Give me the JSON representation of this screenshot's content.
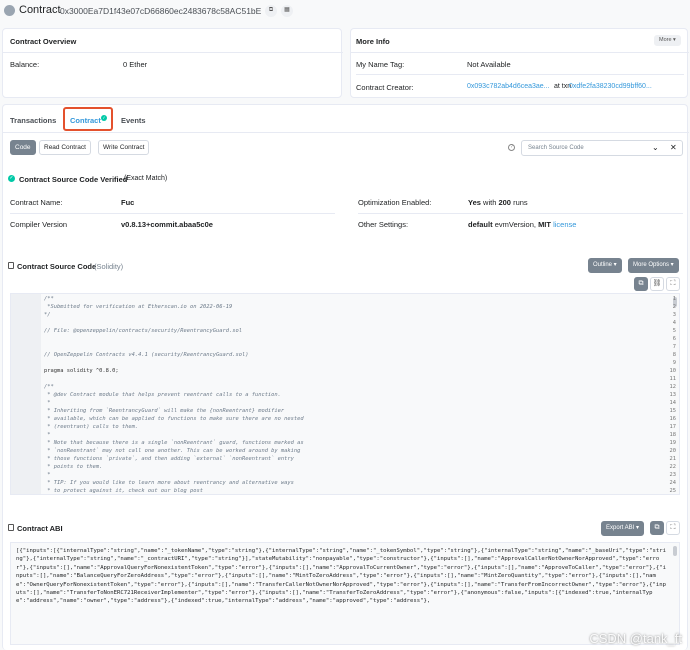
{
  "header": {
    "title": "Contract",
    "address": "0x3000Ea7D1f43e07cD66860ec2483678c58AC51bE"
  },
  "overview": {
    "title": "Contract Overview",
    "balance_label": "Balance:",
    "balance_value": "0 Ether"
  },
  "more_info": {
    "title": "More Info",
    "more_button": "More",
    "name_tag_label": "My Name Tag:",
    "name_tag_value": "Not Available",
    "creator_label": "Contract Creator:",
    "creator_address": "0x093c782ab4d6cea3ae...",
    "creator_at": "at txn",
    "creator_txn": "0xdfe2fa38230cd99bff60..."
  },
  "tabs": {
    "transactions": "Transactions",
    "contract": "Contract",
    "events": "Events"
  },
  "subtabs": {
    "code": "Code",
    "read": "Read Contract",
    "write": "Write Contract"
  },
  "search": {
    "placeholder": "Search Source Code"
  },
  "verified": {
    "text": "Contract Source Code Verified",
    "note": "(Exact Match)"
  },
  "details": {
    "name_label": "Contract Name:",
    "name_value": "Fuc",
    "compiler_label": "Compiler Version",
    "compiler_value": "v0.8.13+commit.abaa5c0e",
    "opt_label": "Optimization Enabled:",
    "opt_yes": "Yes",
    "opt_with": "with",
    "opt_runs": "200",
    "opt_runs_word": "runs",
    "settings_label": "Other Settings:",
    "settings_default": "default",
    "settings_evm": "evmVersion,",
    "settings_mit": "MIT",
    "settings_license": "license"
  },
  "source": {
    "title": "Contract Source Code",
    "lang": "(Solidity)",
    "outline": "Outline",
    "more_options": "More Options"
  },
  "code_lines": [
    {
      "n": "1",
      "t": "/**"
    },
    {
      "n": "2",
      "t": " *Submitted for verification at Etherscan.io on 2022-06-19"
    },
    {
      "n": "3",
      "t": "*/"
    },
    {
      "n": "4",
      "t": ""
    },
    {
      "n": "5",
      "t": "// File: @openzeppelin/contracts/security/ReentrancyGuard.sol"
    },
    {
      "n": "6",
      "t": ""
    },
    {
      "n": "7",
      "t": ""
    },
    {
      "n": "8",
      "t": "// OpenZeppelin Contracts v4.4.1 (security/ReentrancyGuard.sol)"
    },
    {
      "n": "9",
      "t": ""
    },
    {
      "n": "10",
      "t": "pragma solidity ^0.8.0;"
    },
    {
      "n": "11",
      "t": ""
    },
    {
      "n": "12",
      "t": "/**"
    },
    {
      "n": "13",
      "t": " * @dev Contract module that helps prevent reentrant calls to a function."
    },
    {
      "n": "14",
      "t": " *"
    },
    {
      "n": "15",
      "t": " * Inheriting from `ReentrancyGuard` will make the {nonReentrant} modifier"
    },
    {
      "n": "16",
      "t": " * available, which can be applied to functions to make sure there are no nested"
    },
    {
      "n": "17",
      "t": " * (reentrant) calls to them."
    },
    {
      "n": "18",
      "t": " *"
    },
    {
      "n": "19",
      "t": " * Note that because there is a single `nonReentrant` guard, functions marked as"
    },
    {
      "n": "20",
      "t": " * `nonReentrant` may not call one another. This can be worked around by making"
    },
    {
      "n": "21",
      "t": " * those functions `private`, and then adding `external` `nonReentrant` entry"
    },
    {
      "n": "22",
      "t": " * points to them."
    },
    {
      "n": "23",
      "t": " *"
    },
    {
      "n": "24",
      "t": " * TIP: If you would like to learn more about reentrancy and alternative ways"
    },
    {
      "n": "25",
      "t": " * to protect against it, check out our blog post"
    }
  ],
  "abi": {
    "title": "Contract ABI",
    "export": "Export ABI",
    "text": "[{\"inputs\":[{\"internalType\":\"string\",\"name\":\"_tokenName\",\"type\":\"string\"},{\"internalType\":\"string\",\"name\":\"_tokenSymbol\",\"type\":\"string\"},{\"internalType\":\"string\",\"name\":\"_baseUri\",\"type\":\"string\"},{\"internalType\":\"string\",\"name\":\"_contractURI\",\"type\":\"string\"}],\"stateMutability\":\"nonpayable\",\"type\":\"constructor\"},{\"inputs\":[],\"name\":\"ApprovalCallerNotOwnerNorApproved\",\"type\":\"error\"},{\"inputs\":[],\"name\":\"ApprovalQueryForNonexistentToken\",\"type\":\"error\"},{\"inputs\":[],\"name\":\"ApprovalToCurrentOwner\",\"type\":\"error\"},{\"inputs\":[],\"name\":\"ApproveToCaller\",\"type\":\"error\"},{\"inputs\":[],\"name\":\"BalanceQueryForZeroAddress\",\"type\":\"error\"},{\"inputs\":[],\"name\":\"MintToZeroAddress\",\"type\":\"error\"},{\"inputs\":[],\"name\":\"MintZeroQuantity\",\"type\":\"error\"},{\"inputs\":[],\"name\":\"OwnerQueryForNonexistentToken\",\"type\":\"error\"},{\"inputs\":[],\"name\":\"TransferCallerNotOwnerNorApproved\",\"type\":\"error\"},{\"inputs\":[],\"name\":\"TransferFromIncorrectOwner\",\"type\":\"error\"},{\"inputs\":[],\"name\":\"TransferToNonERC721ReceiverImplementer\",\"type\":\"error\"},{\"inputs\":[],\"name\":\"TransferToZeroAddress\",\"type\":\"error\"},{\"anonymous\":false,\"inputs\":[{\"indexed\":true,\"internalType\":\"address\",\"name\":\"owner\",\"type\":\"address\"},{\"indexed\":true,\"internalType\":\"address\",\"name\":\"approved\",\"type\":\"address\"},"
  },
  "watermark": "CSDN @tank_ft"
}
